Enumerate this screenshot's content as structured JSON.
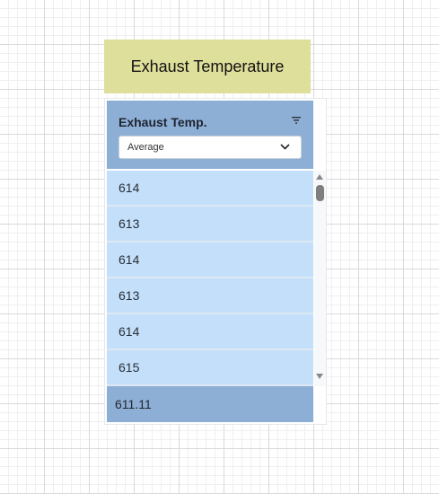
{
  "title_card": {
    "label": "Exhaust Temperature",
    "color": "#dedf9b"
  },
  "column": {
    "header": "Exhaust Temp.",
    "filter_icon": "filter-icon",
    "aggregation": {
      "selected": "Average",
      "icon": "chevron-down-icon"
    },
    "rows": [
      "614",
      "613",
      "614",
      "613",
      "614",
      "615"
    ],
    "footer_value": "611.11",
    "colors": {
      "header": "#8eafd5",
      "row": "#c3dffa",
      "footer": "#8eafd5"
    }
  },
  "scrollbar": {
    "up_icon": "arrow-up-icon",
    "down_icon": "arrow-down-icon"
  }
}
